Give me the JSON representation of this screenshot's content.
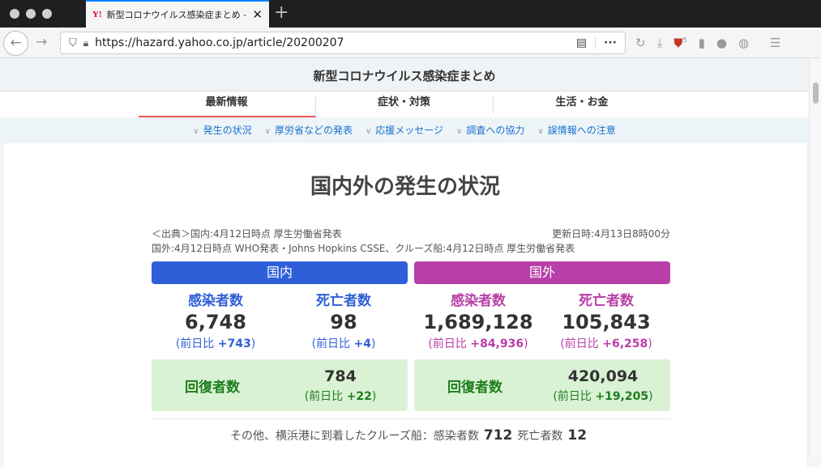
{
  "browser": {
    "tab_title": "新型コロナウイルス感染症まとめ - Y",
    "favicon": "Y!",
    "url": "https://hazard.yahoo.co.jp/article/20200207",
    "ublock_badge": "5"
  },
  "header": {
    "title": "新型コロナウイルス感染症まとめ"
  },
  "nav": {
    "tabs": [
      {
        "label": "最新情報"
      },
      {
        "label": "症状・対策"
      },
      {
        "label": "生活・お金"
      }
    ]
  },
  "subnav": {
    "items": [
      {
        "label": "発生の状況"
      },
      {
        "label": "厚労省などの発表"
      },
      {
        "label": "応援メッセージ"
      },
      {
        "label": "調査への協力"
      },
      {
        "label": "誤情報への注意"
      }
    ]
  },
  "main": {
    "title": "国内外の発生の状況",
    "source_line1": "＜出典＞国内:4月12日時点 厚生労働省発表",
    "source_line2": "国外:4月12日時点 WHO発表・Johns Hopkins CSSE、クルーズ船:4月12日時点 厚生労働省発表",
    "updated": "更新日時:4月13日8時00分",
    "diff_prefix": "(前日比 ",
    "diff_suffix": ")",
    "recovered_label": "回復者数",
    "domestic": {
      "label": "国内",
      "color": "#2f5fd8",
      "infected_label": "感染者数",
      "infected": "6,748",
      "infected_diff": "+743",
      "deaths_label": "死亡者数",
      "deaths": "98",
      "deaths_diff": "+4",
      "recovered": "784",
      "recovered_diff": "+22"
    },
    "overseas": {
      "label": "国外",
      "color": "#b83fa8",
      "infected_label": "感染者数",
      "infected": "1,689,128",
      "infected_diff": "+84,936",
      "deaths_label": "死亡者数",
      "deaths": "105,843",
      "deaths_diff": "+6,258",
      "recovered": "420,094",
      "recovered_diff": "+19,205"
    },
    "cruise": {
      "text": "その他、横浜港に到着したクルーズ船：感染者数",
      "infected": "712",
      "deaths_label": "死亡者数",
      "deaths": "12"
    }
  }
}
